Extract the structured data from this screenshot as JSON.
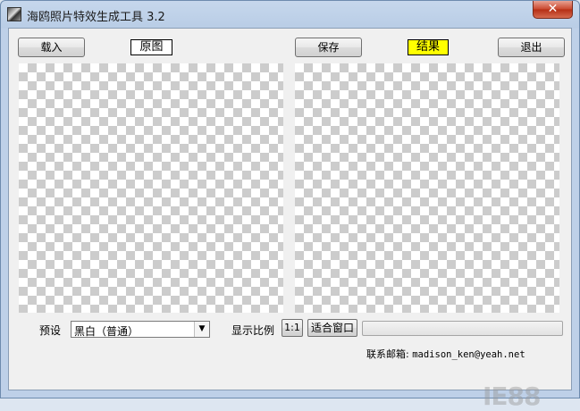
{
  "window": {
    "title": "海鸥照片特效生成工具 3.2",
    "close_label": "✕"
  },
  "toolbar": {
    "load_label": "载入",
    "original_label": "原图",
    "save_label": "保存",
    "result_label": "结果",
    "exit_label": "退出"
  },
  "bottom": {
    "preset_label": "预设",
    "preset_value": "黑白（普通）",
    "display_ratio_label": "显示比例",
    "ratio_button_label": "1:1",
    "fit_window_label": "适合窗口",
    "progress": 0
  },
  "contact": {
    "label": "联系邮箱:",
    "email": "madison_ken@yeah.net"
  },
  "watermark": "IE88",
  "colors": {
    "result_tag_bg": "#ffff00",
    "close_button": "#c9462c",
    "checker_dark": "#cccccc",
    "checker_light": "#ffffff"
  },
  "icons": {
    "app": "app-icon",
    "dropdown": "chevron-down-icon",
    "close": "close-icon"
  }
}
